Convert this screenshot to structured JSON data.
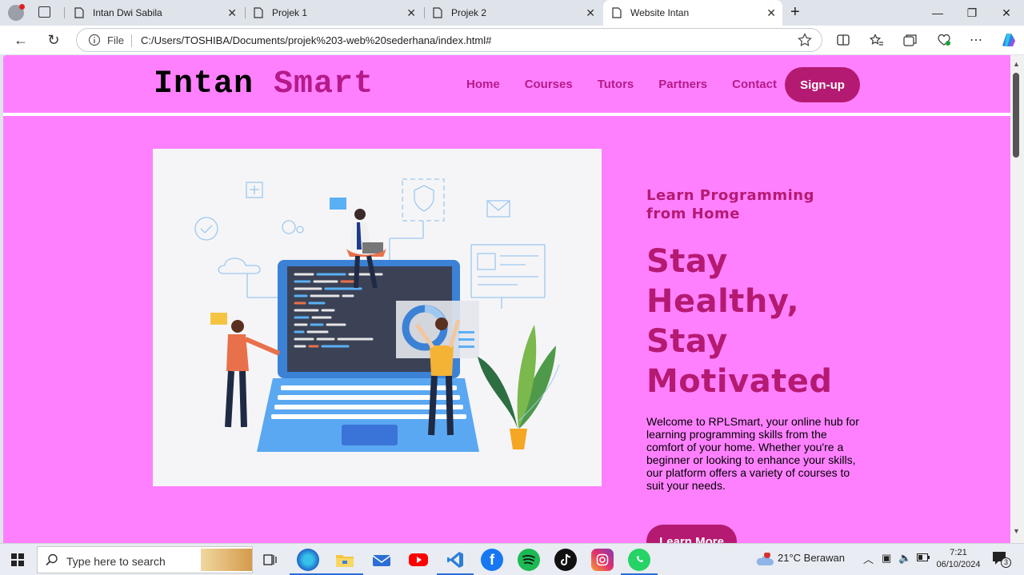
{
  "browser": {
    "tabs": [
      {
        "title": "Intan Dwi Sabila"
      },
      {
        "title": "Projek 1"
      },
      {
        "title": "Projek 2"
      },
      {
        "title": "Website Intan"
      }
    ],
    "address": {
      "scheme_label": "File",
      "url": "C:/Users/TOSHIBA/Documents/projek%203-web%20sederhana/index.html#"
    }
  },
  "site": {
    "logo_part1": "Intan",
    "logo_part2": "Smart",
    "nav": [
      "Home",
      "Courses",
      "Tutors",
      "Partners",
      "Contact"
    ],
    "signup_label": "Sign-up",
    "hero": {
      "subtitle": "Learn Programming from Home",
      "headline": "Stay Healthy, Stay Motivated",
      "description": "Welcome to RPLSmart, your online hub for learning programming skills from the comfort of your home. Whether you're a beginner or looking to enhance your skills, our platform offers a variety of courses to suit your needs.",
      "cta_label": "Learn More"
    }
  },
  "taskbar": {
    "search_placeholder": "Type here to search",
    "weather": "21°C  Berawan",
    "time": "7:21",
    "date": "06/10/2024",
    "notification_count": "3"
  },
  "colors": {
    "page_bg": "#ff80ff",
    "brand": "#b51a72",
    "logo_accent": "#b51a8a"
  }
}
